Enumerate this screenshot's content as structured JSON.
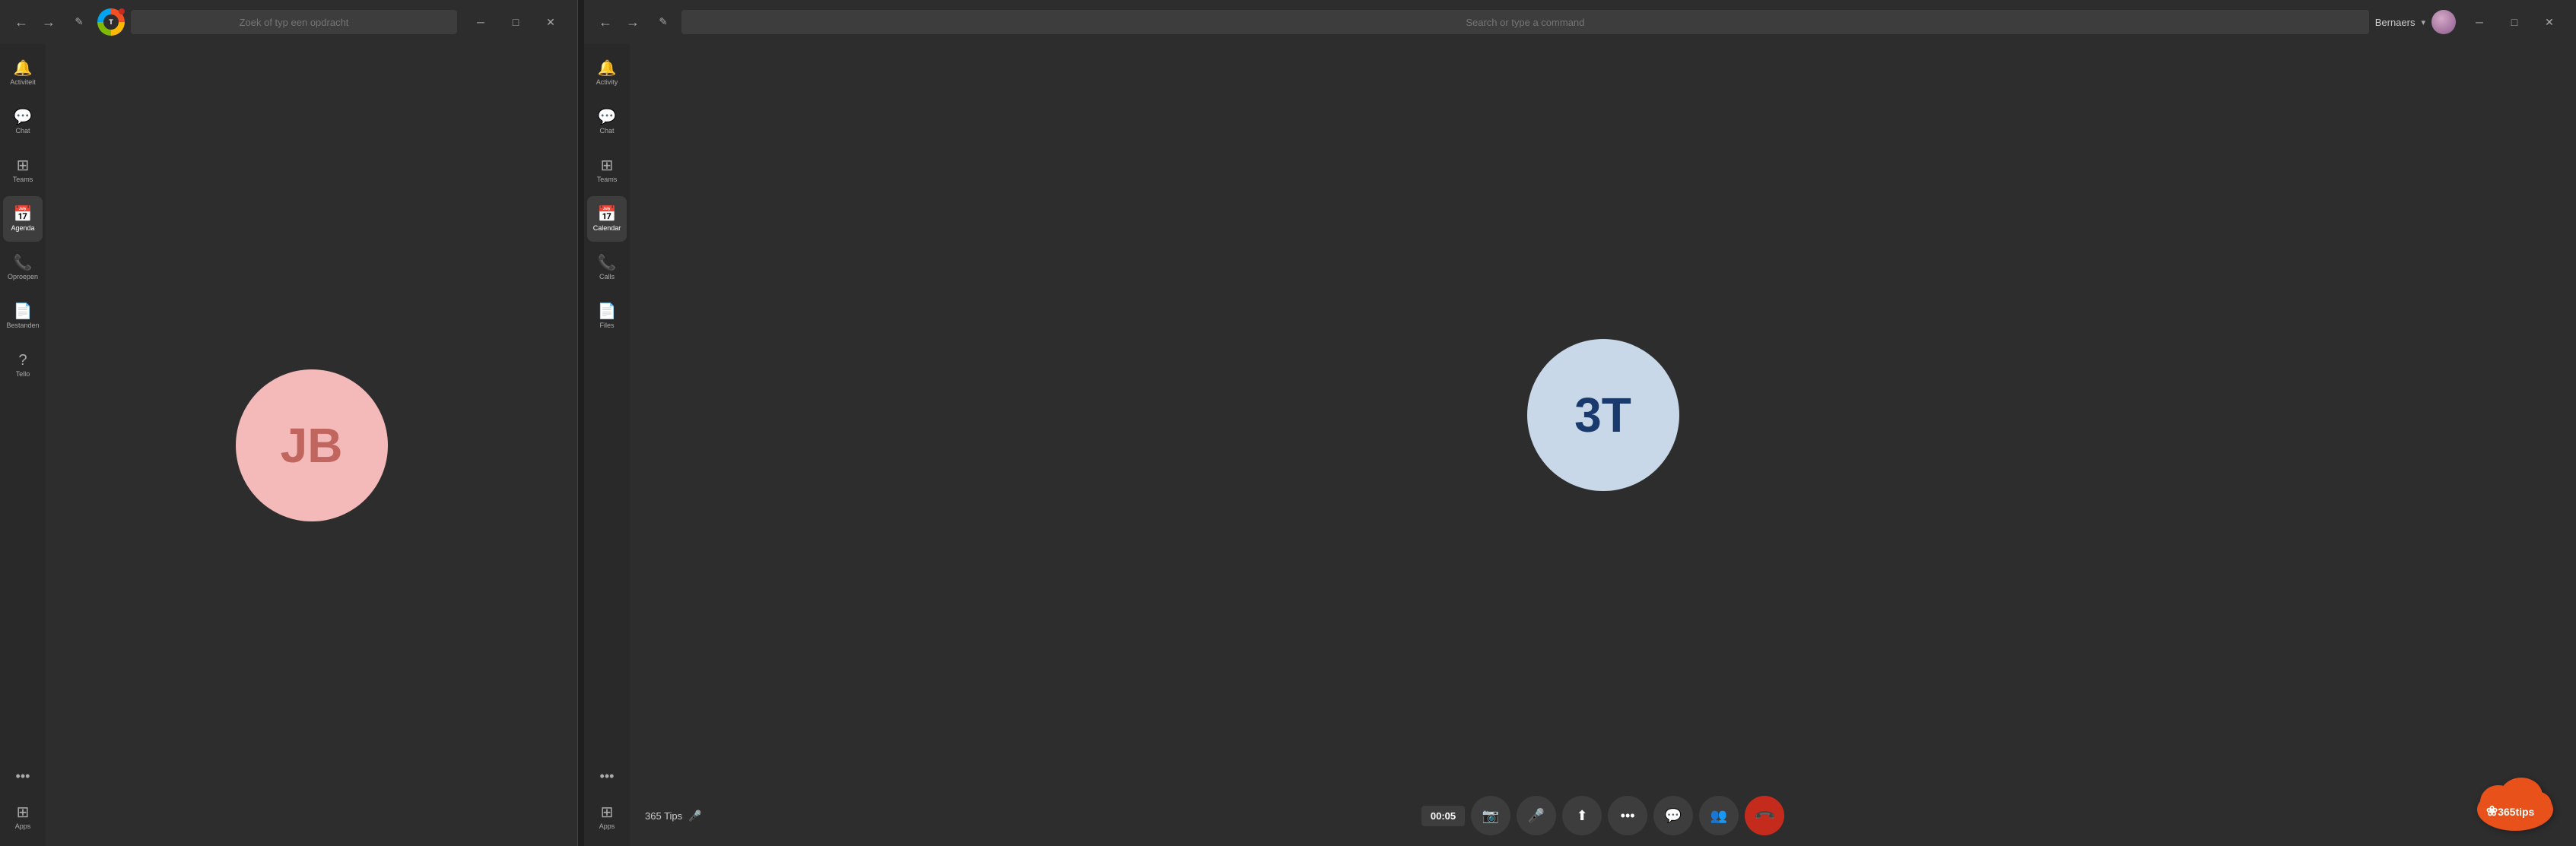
{
  "left_window": {
    "titlebar": {
      "back_label": "←",
      "forward_label": "→",
      "edit_label": "✎",
      "search_placeholder": "Zoek of typ een opdracht",
      "minimize_label": "─",
      "maximize_label": "□",
      "close_label": "✕"
    },
    "sidebar": {
      "items": [
        {
          "id": "activity",
          "label": "Activiteit",
          "icon": "🔔"
        },
        {
          "id": "chat",
          "label": "Chat",
          "icon": "💬"
        },
        {
          "id": "teams",
          "label": "Teams",
          "icon": "⊞"
        },
        {
          "id": "calendar",
          "label": "Agenda",
          "icon": "📅",
          "active": true
        },
        {
          "id": "calls",
          "label": "Oproepen",
          "icon": "📞"
        },
        {
          "id": "files",
          "label": "Bestanden",
          "icon": "📄"
        },
        {
          "id": "help",
          "label": "Tello",
          "icon": "?"
        }
      ],
      "more_label": "•••",
      "apps_label": "Apps"
    },
    "main": {
      "avatar": {
        "initials": "JB",
        "color": "#f4baba",
        "text_color": "#c0665e"
      }
    }
  },
  "right_window": {
    "titlebar": {
      "back_label": "←",
      "forward_label": "→",
      "edit_label": "✎",
      "search_placeholder": "Search or type a command",
      "user_name": "Bernaers",
      "minimize_label": "─",
      "maximize_label": "□",
      "close_label": "✕"
    },
    "sidebar": {
      "items": [
        {
          "id": "activity",
          "label": "Activity",
          "icon": "🔔"
        },
        {
          "id": "chat",
          "label": "Chat",
          "icon": "💬"
        },
        {
          "id": "teams",
          "label": "Teams",
          "icon": "⊞"
        },
        {
          "id": "calendar",
          "label": "Calendar",
          "icon": "📅",
          "active": true
        },
        {
          "id": "calls",
          "label": "Calls",
          "icon": "📞"
        },
        {
          "id": "files",
          "label": "Files",
          "icon": "📄"
        }
      ],
      "more_label": "•••",
      "apps_label": "Apps"
    },
    "call": {
      "avatar": {
        "initials": "3T",
        "color": "#c8d8e8",
        "text_color": "#1a3a6e"
      },
      "caller_name": "365 Tips",
      "timer": "00:05",
      "controls": {
        "video_label": "📷",
        "mute_label": "🎤",
        "share_label": "↑",
        "more_label": "•••",
        "chat_label": "💬",
        "participants_label": "👥",
        "end_label": "📞"
      }
    },
    "tips_logo": {
      "text": "365tips"
    }
  }
}
